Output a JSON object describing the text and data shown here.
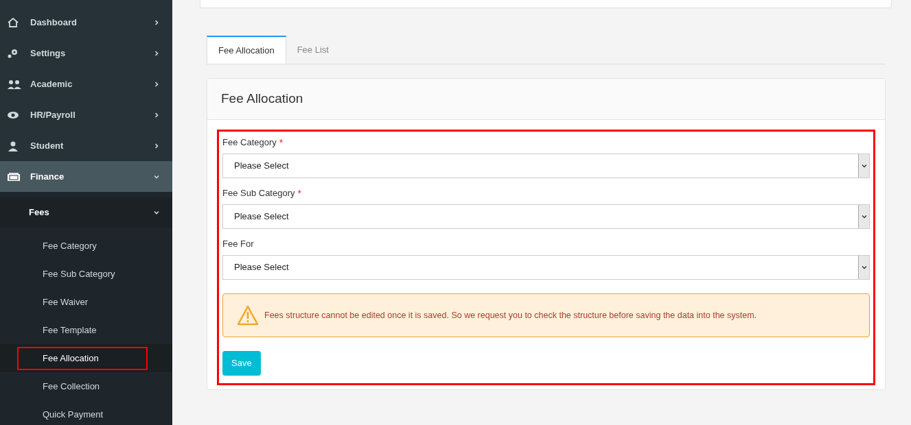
{
  "sidebar": {
    "items": [
      {
        "label": "Dashboard",
        "expanded": false,
        "selected": false
      },
      {
        "label": "Settings",
        "expanded": false,
        "selected": false
      },
      {
        "label": "Academic",
        "expanded": false,
        "selected": false
      },
      {
        "label": "HR/Payroll",
        "expanded": false,
        "selected": false
      },
      {
        "label": "Student",
        "expanded": false,
        "selected": false
      },
      {
        "label": "Finance",
        "expanded": true,
        "selected": true,
        "children": [
          {
            "label": "Fees",
            "expanded": true,
            "children": [
              {
                "label": "Fee Category",
                "selected": false
              },
              {
                "label": "Fee Sub Category",
                "selected": false
              },
              {
                "label": "Fee Waiver",
                "selected": false
              },
              {
                "label": "Fee Template",
                "selected": false
              },
              {
                "label": "Fee Allocation",
                "selected": true
              },
              {
                "label": "Fee Collection",
                "selected": false
              },
              {
                "label": "Quick Payment",
                "selected": false
              }
            ]
          }
        ]
      }
    ]
  },
  "tabs": [
    {
      "label": "Fee Allocation",
      "selected": true
    },
    {
      "label": "Fee List",
      "selected": false
    }
  ],
  "card": {
    "title": "Fee Allocation",
    "fields": [
      {
        "label": "Fee Category",
        "required_mark": "*",
        "placeholder": "Please Select"
      },
      {
        "label": "Fee Sub Category",
        "required_mark": "*",
        "placeholder": "Please Select"
      },
      {
        "label": "Fee For",
        "placeholder": "Please Select"
      }
    ],
    "warning": "Fees structure cannot be edited once it is saved. So we request you to check the structure before saving the data into the system.",
    "button": "Save"
  }
}
